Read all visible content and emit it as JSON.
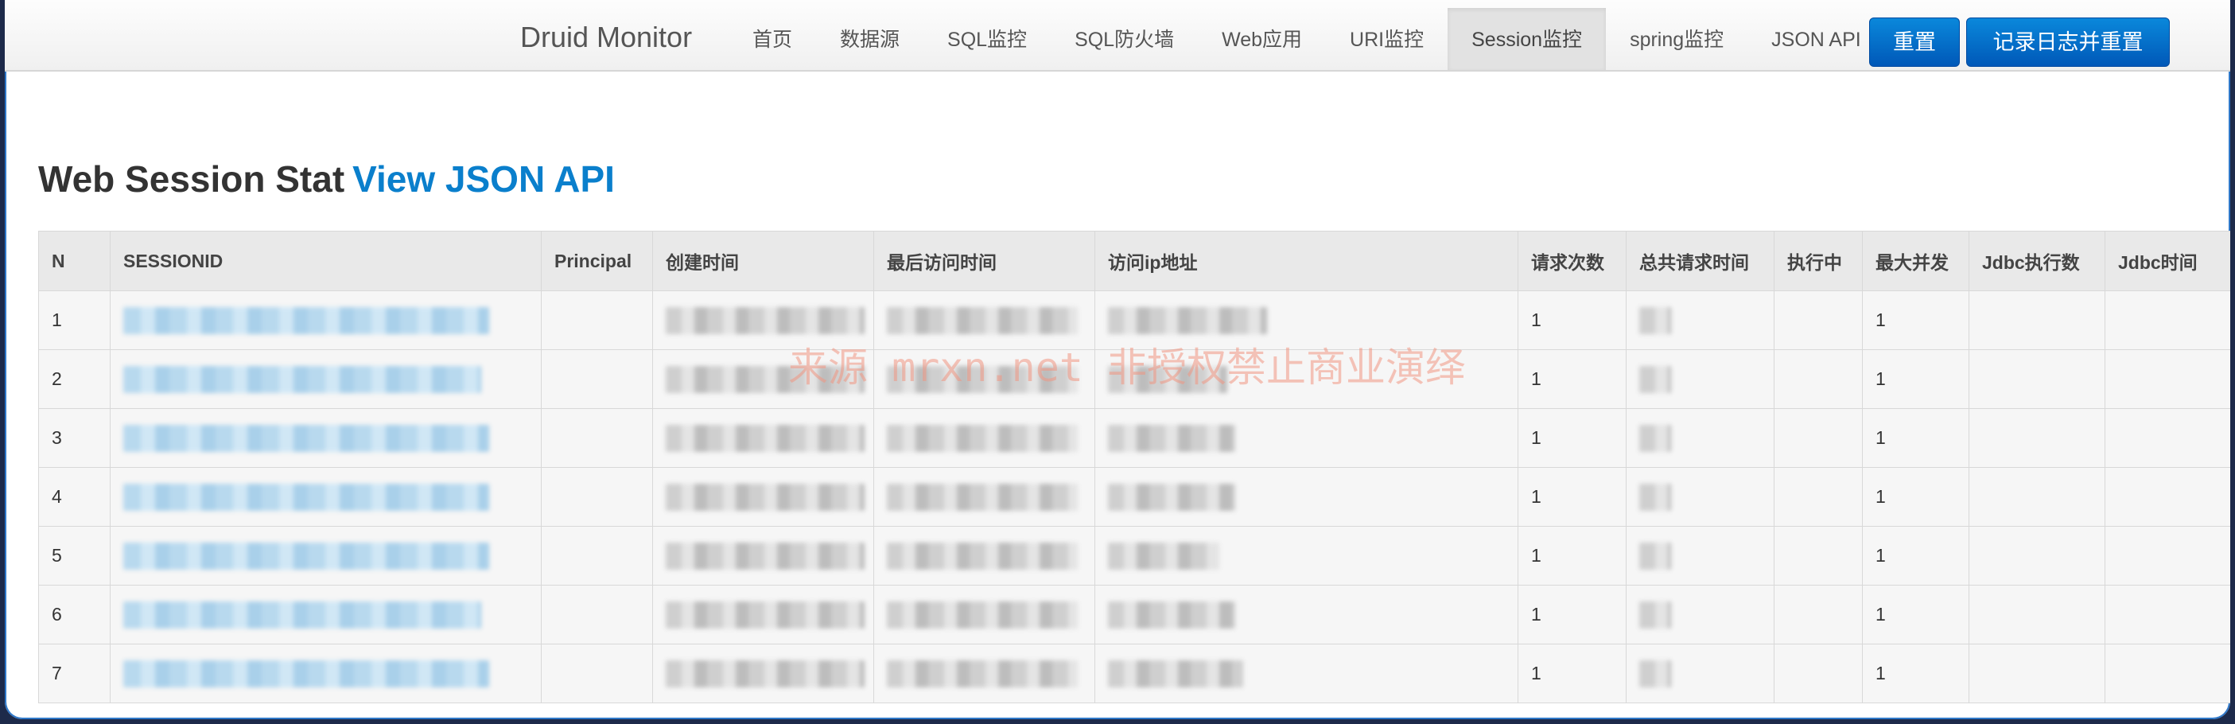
{
  "brand": "Druid Monitor",
  "nav": [
    "首页",
    "数据源",
    "SQL监控",
    "SQL防火墙",
    "Web应用",
    "URI监控",
    "Session监控",
    "spring监控",
    "JSON API"
  ],
  "active_nav": "Session监控",
  "buttons": {
    "reset": "重置",
    "log_reset": "记录日志并重置"
  },
  "heading": {
    "title": "Web Session Stat",
    "link": "View JSON API"
  },
  "watermark": "来源 mrxn.net 非授权禁止商业演绎",
  "table": {
    "columns": [
      "N",
      "SESSIONID",
      "Principal",
      "创建时间",
      "最后访问时间",
      "访问ip地址",
      "请求次数",
      "总共请求时间",
      "执行中",
      "最大并发",
      "Jdbc执行数",
      "Jdbc时间"
    ],
    "rows": [
      {
        "n": "1",
        "requests": "1",
        "max_concurrent": "1"
      },
      {
        "n": "2",
        "requests": "1",
        "max_concurrent": "1"
      },
      {
        "n": "3",
        "requests": "1",
        "max_concurrent": "1"
      },
      {
        "n": "4",
        "requests": "1",
        "max_concurrent": "1"
      },
      {
        "n": "5",
        "requests": "1",
        "max_concurrent": "1"
      },
      {
        "n": "6",
        "requests": "1",
        "max_concurrent": "1"
      },
      {
        "n": "7",
        "requests": "1",
        "max_concurrent": "1"
      }
    ]
  },
  "colors": {
    "accent": "#0a7fcc",
    "button": "#0a6fce"
  }
}
